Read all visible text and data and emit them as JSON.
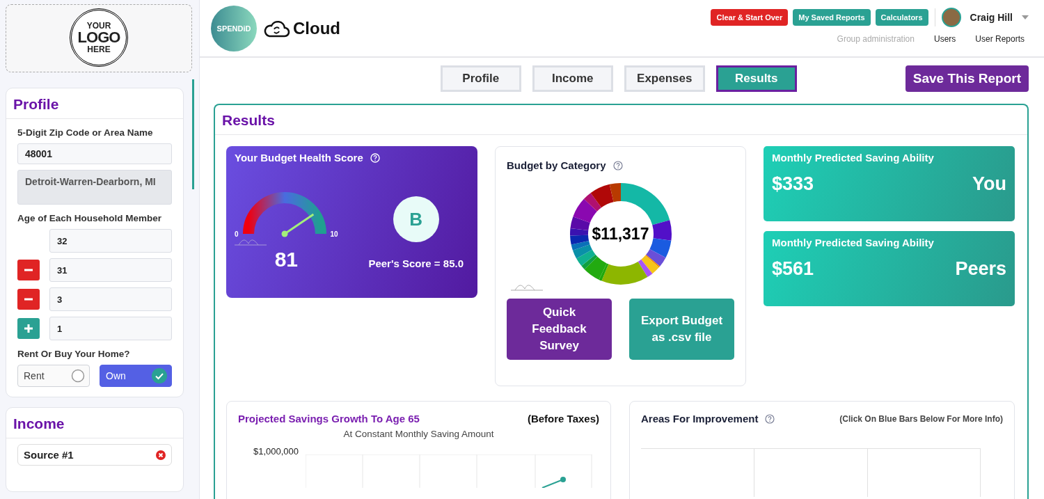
{
  "sidebar": {
    "logo": {
      "top": "YOUR",
      "middle": "LOGO",
      "bottom": "HERE"
    },
    "profile": {
      "title": "Profile",
      "zip_label": "5-Digit Zip Code or Area Name",
      "zip_value": "48001",
      "area_value": "Detroit-Warren-Dearborn, MI",
      "ages_label": "Age of Each Household Member",
      "ages": [
        {
          "kind": "plain",
          "value": "32"
        },
        {
          "kind": "remove",
          "value": "31"
        },
        {
          "kind": "remove",
          "value": "3"
        },
        {
          "kind": "add",
          "value": "1"
        }
      ],
      "home_label": "Rent Or Buy Your Home?",
      "home_options": [
        {
          "label": "Rent",
          "selected": false
        },
        {
          "label": "Own",
          "selected": true
        }
      ]
    },
    "income": {
      "title": "Income",
      "source": "Source #1"
    }
  },
  "header": {
    "brand": "SPENDiD",
    "product": "Cloud",
    "buttons": [
      {
        "label": "Clear & Start Over",
        "kind": "danger"
      },
      {
        "label": "My Saved Reports",
        "kind": "primary"
      },
      {
        "label": "Calculators",
        "kind": "primary"
      }
    ],
    "user": "Craig Hill",
    "links": [
      {
        "label": "Group administration",
        "disabled": true
      },
      {
        "label": "Users",
        "disabled": false
      },
      {
        "label": "User Reports",
        "disabled": false
      }
    ]
  },
  "tabs": [
    {
      "label": "Profile",
      "selected": false
    },
    {
      "label": "Income",
      "selected": false
    },
    {
      "label": "Expenses",
      "selected": false
    },
    {
      "label": "Results",
      "selected": true
    }
  ],
  "save_button": "Save This Report",
  "results": {
    "title": "Results",
    "health": {
      "title": "Your Budget Health Score",
      "min": "0",
      "max": "10",
      "level": 0.81,
      "score": "81",
      "grade": "B",
      "peer": "Peer's Score = 85.0"
    },
    "category": {
      "title": "Budget by Category",
      "total": "$11,317",
      "buttons": [
        {
          "label": "Quick Feedback Survey",
          "kind": "survey"
        },
        {
          "label": "Export Budget as .csv file",
          "kind": "export"
        }
      ]
    },
    "savings": [
      {
        "title": "Monthly Predicted Saving Ability",
        "amount": "$333",
        "who": "You"
      },
      {
        "title": "Monthly Predicted Saving Ability",
        "amount": "$561",
        "who": "Peers"
      }
    ],
    "projection": {
      "title": "Projected Savings Growth To Age 65",
      "note": "(Before Taxes)",
      "subtitle": "At Constant Monthly Saving Amount",
      "y_label": "$1,000,000"
    },
    "improvement": {
      "title": "Areas For Improvement",
      "note": "(Click On Blue Bars Below For More Info)"
    }
  }
}
